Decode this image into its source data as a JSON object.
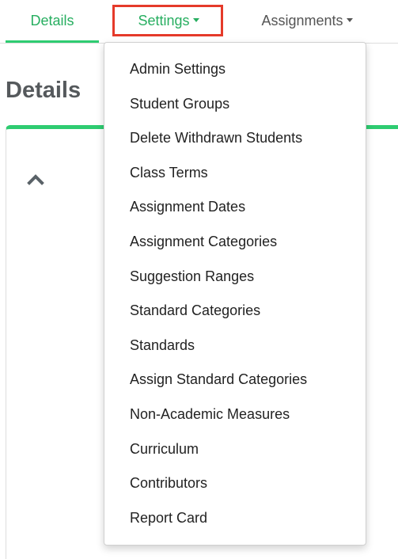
{
  "tabs": {
    "details": "Details",
    "settings": "Settings",
    "assignments": "Assignments"
  },
  "section": {
    "title": "Details"
  },
  "settings_menu": {
    "items": [
      "Admin Settings",
      "Student Groups",
      "Delete Withdrawn Students",
      "Class Terms",
      "Assignment Dates",
      "Assignment Categories",
      "Suggestion Ranges",
      "Standard Categories",
      "Standards",
      "Assign Standard Categories",
      "Non-Academic Measures",
      "Curriculum",
      "Contributors",
      "Report Card"
    ]
  },
  "colors": {
    "accent": "#2ecc71",
    "active_text": "#27ae60",
    "highlight_box": "#e53a2a"
  },
  "icons": {
    "settings_caret": "caret-down-icon",
    "assignments_caret": "caret-down-icon",
    "panel_collapse": "chevron-up-icon"
  }
}
